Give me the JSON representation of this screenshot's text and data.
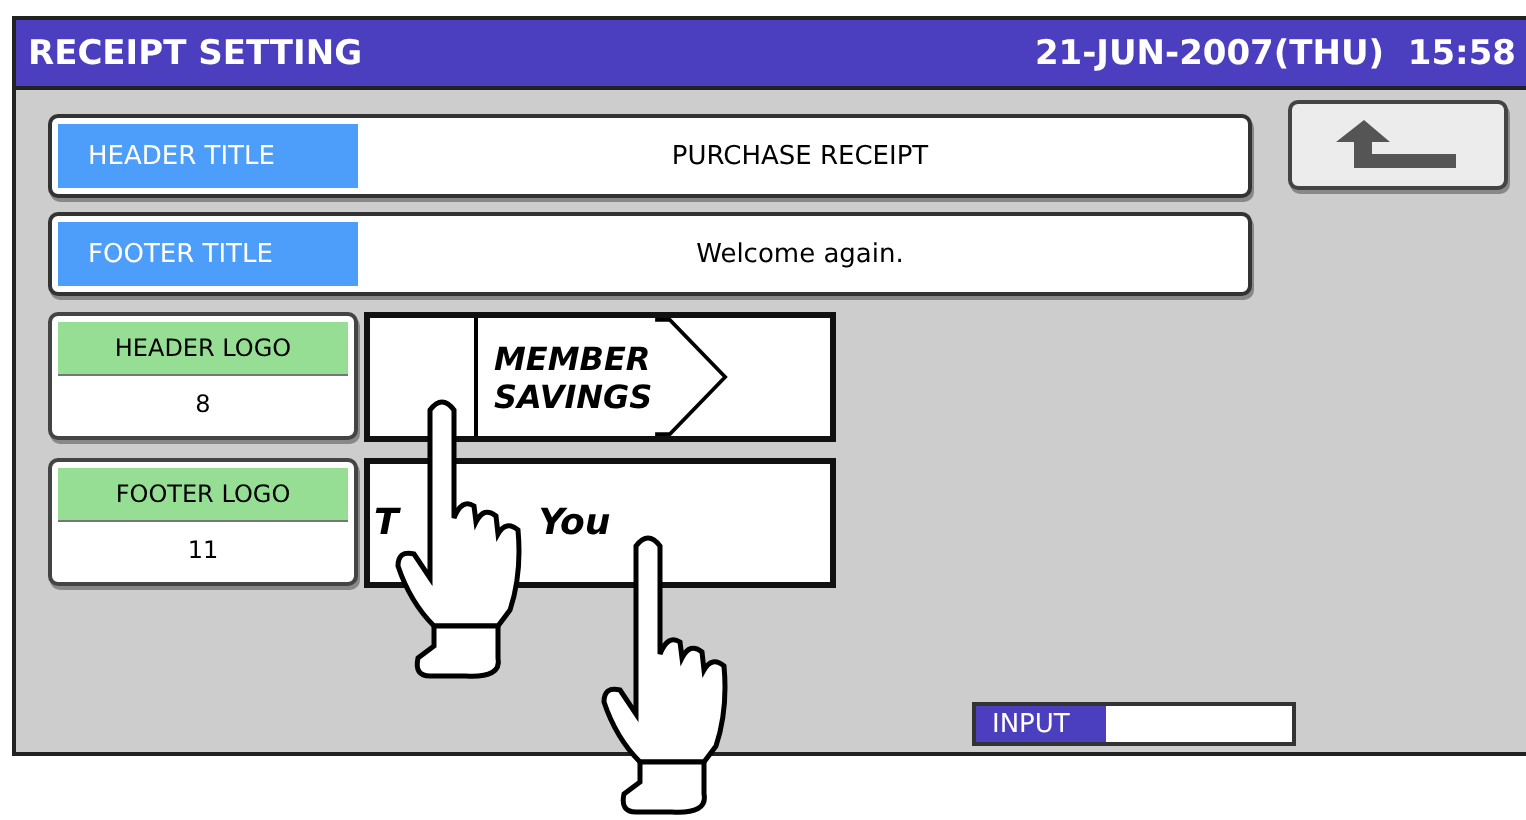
{
  "title_bar": {
    "title": "RECEIPT SETTING",
    "datetime": "21-JUN-2007(THU)  15:58"
  },
  "title_rows": [
    {
      "label": "HEADER TITLE",
      "value": "PURCHASE RECEIPT"
    },
    {
      "label": "FOOTER TITLE",
      "value": "Welcome again."
    }
  ],
  "logo_rows": [
    {
      "label": "HEADER LOGO",
      "number": "8",
      "kind": "sign",
      "logo_lines": [
        "MEMBER",
        "SAVINGS"
      ]
    },
    {
      "label": "FOOTER LOGO",
      "number": "11",
      "kind": "words",
      "logo_lines": [
        "T",
        "You"
      ]
    }
  ],
  "input_bar": {
    "label": "INPUT"
  }
}
